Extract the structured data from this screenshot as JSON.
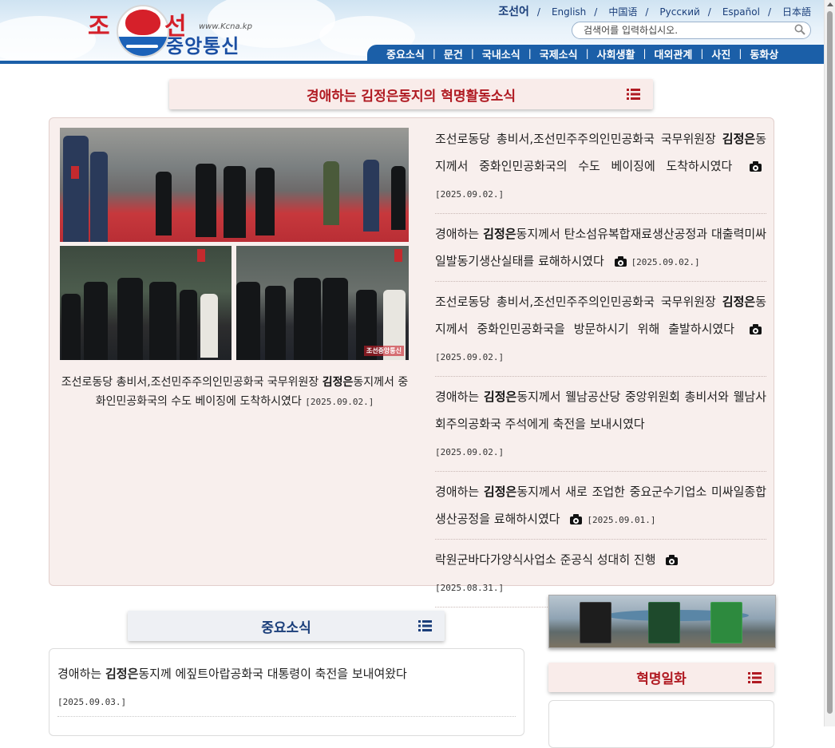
{
  "header": {
    "logo": {
      "text_left": "조",
      "text_right": "선",
      "text_bottom": "중앙통신",
      "url": "www.Kcna.kp"
    },
    "languages": [
      {
        "label": "조선어",
        "active": true
      },
      {
        "label": "English"
      },
      {
        "label": "中国语"
      },
      {
        "label": "Русский"
      },
      {
        "label": "Español"
      },
      {
        "label": "日本語"
      }
    ],
    "lang_separator": "/",
    "search": {
      "placeholder": "검색어를 입력하십시오."
    },
    "nav": [
      "중요소식",
      "문건",
      "국내소식",
      "국제소식",
      "사회생활",
      "대외관계",
      "사진",
      "동화상"
    ],
    "nav_separator": "|"
  },
  "revolutionary": {
    "title": "경애하는 김정은동지의 혁명활동소식",
    "featured": {
      "prefix": "조선로동당 총비서,조선민주주의인민공화국 국무위원장 ",
      "name": "김정은",
      "suffix": "동지께서 중화인민공화국의 수도 베이징에 도착하시였다",
      "date": "[2025.09.02.]"
    },
    "photo_watermark": "조선중앙통신",
    "items": [
      {
        "prefix": "조선로동당 총비서,조선민주주의인민공화국 국무위원장 ",
        "name": "김정은",
        "suffix": "동지께서 중화인민공화국의 수도 베이징에 도착하시였다",
        "photo": true,
        "date": "[2025.09.02.]"
      },
      {
        "prefix": "경애하는 ",
        "name": "김정은",
        "suffix": "동지께서 탄소섬유복합재료생산공정과 대출력미싸일발동기생산실태를 료해하시였다",
        "photo": true,
        "date": "[2025.09.02.]"
      },
      {
        "prefix": "조선로동당 총비서,조선민주주의인민공화국 국무위원장 ",
        "name": "김정은",
        "suffix": "동지께서 중화인민공화국을 방문하시기 위해 출발하시였다",
        "photo": true,
        "date": "[2025.09.02.]"
      },
      {
        "prefix": "경애하는 ",
        "name": "김정은",
        "suffix": "동지께서 웰남공산당 중앙위원회 총비서와 웰남사회주의공화국 주석에게 축전을 보내시였다",
        "photo": false,
        "date": "[2025.09.02.]"
      },
      {
        "prefix": "경애하는 ",
        "name": "김정은",
        "suffix": "동지께서 새로 조업한 중요군수기업소 미싸일종합생산공정을 료해하시였다",
        "photo": true,
        "date": "[2025.09.01.]"
      },
      {
        "prefix": "",
        "name": "",
        "suffix": "락원군바다가양식사업소 준공식 성대히 진행",
        "photo": true,
        "date": "[2025.08.31.]"
      }
    ]
  },
  "important_news": {
    "title": "중요소식",
    "items": [
      {
        "prefix": "경애하는 ",
        "name": "김정은",
        "suffix": "동지께 에짚트아랍공화국 대통령이 축전을 보내여왔다",
        "date": "[2025.09.03.]"
      }
    ]
  },
  "sidebar": {
    "revolutionary_anecdote_title": "혁명일화"
  },
  "colors": {
    "nav_blue": "#1b5fa8",
    "title_red": "#b01a22",
    "important_blue": "#1a3e7a"
  }
}
